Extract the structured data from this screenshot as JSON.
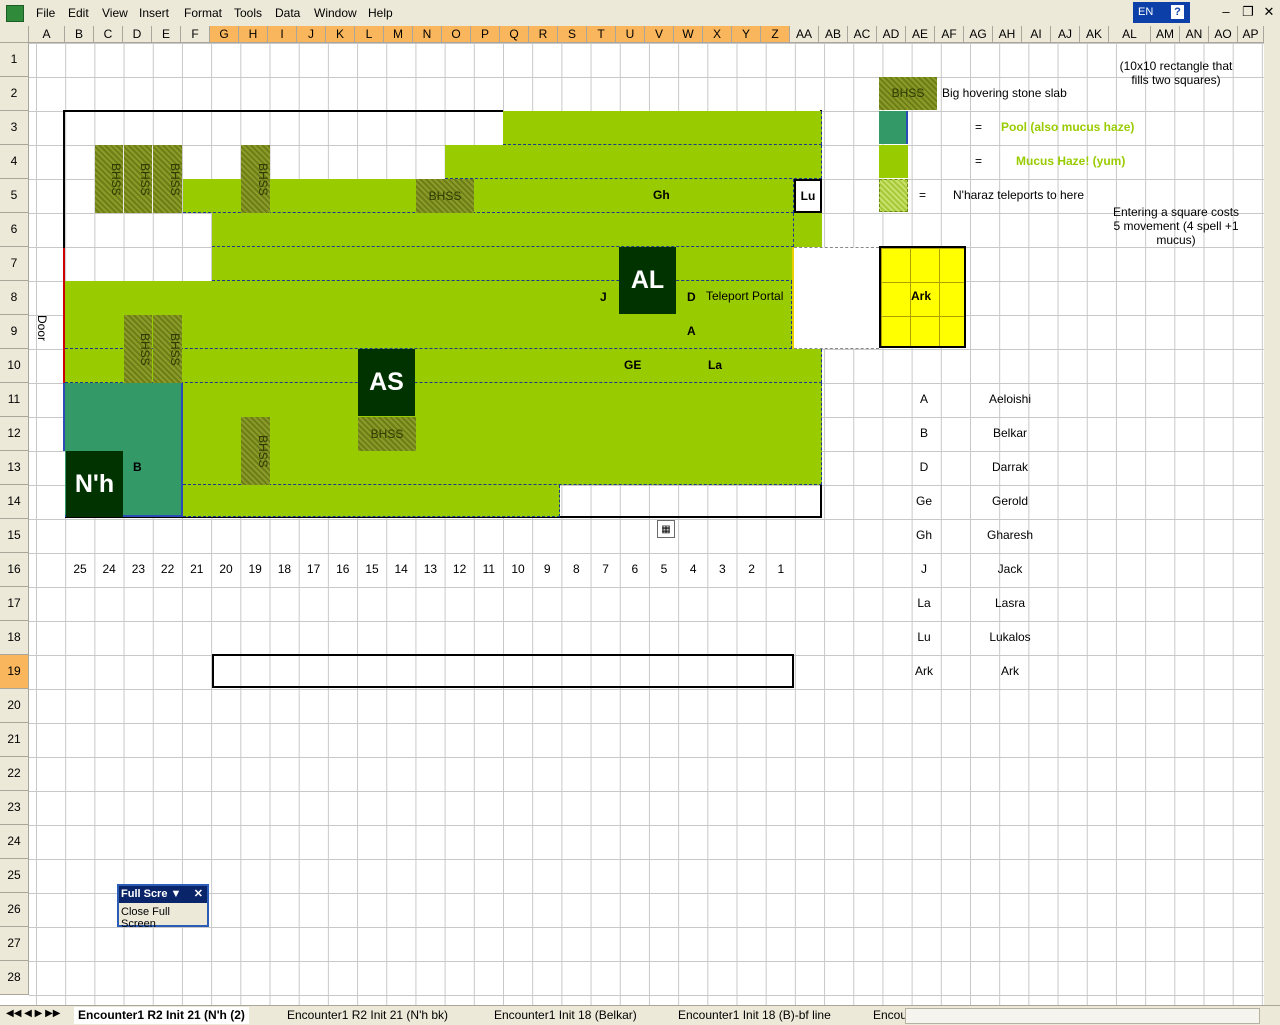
{
  "menu": [
    "File",
    "Edit",
    "View",
    "Insert",
    "Format",
    "Tools",
    "Data",
    "Window",
    "Help"
  ],
  "lang": "EN",
  "help": "?",
  "columns": [
    "A",
    "B",
    "C",
    "D",
    "E",
    "F",
    "G",
    "H",
    "I",
    "J",
    "K",
    "L",
    "M",
    "N",
    "O",
    "P",
    "Q",
    "R",
    "S",
    "T",
    "U",
    "V",
    "W",
    "X",
    "Y",
    "Z",
    "AA",
    "AB",
    "AC",
    "AD",
    "AE",
    "AF",
    "AG",
    "AH",
    "AI",
    "AJ",
    "AK",
    "AL",
    "AM",
    "AN",
    "AO",
    "AP"
  ],
  "rows": [
    "1",
    "2",
    "3",
    "4",
    "5",
    "6",
    "7",
    "8",
    "9",
    "10",
    "11",
    "12",
    "13",
    "14",
    "15",
    "16",
    "17",
    "18",
    "19",
    "20",
    "21",
    "22",
    "23",
    "24",
    "25",
    "26",
    "27",
    "28"
  ],
  "selected_row": "19",
  "map": {
    "door": "Door",
    "teleport": "Teleport Portal",
    "bhss": "BHSS",
    "tokens": {
      "AL": "AL",
      "AS": "AS",
      "Nh": "N'h",
      "Gh": "Gh",
      "Lu": "Lu",
      "J": "J",
      "D": "D",
      "A": "A",
      "GE": "GE",
      "La": "La",
      "B": "B"
    },
    "numbers": [
      "25",
      "24",
      "23",
      "22",
      "21",
      "20",
      "19",
      "18",
      "17",
      "16",
      "15",
      "14",
      "13",
      "12",
      "11",
      "10",
      "9",
      "8",
      "7",
      "6",
      "5",
      "4",
      "3",
      "2",
      "1"
    ]
  },
  "legend": {
    "note1": "(10x10 rectangle that fills two squares)",
    "bhss_label": "BHSS",
    "bhss_desc": "Big hovering stone slab",
    "eq": "=",
    "pool": "Pool (also mucus haze)",
    "mucus": "Mucus Haze! (yum)",
    "teleport_desc": "N'haraz teleports to here",
    "cost": "Entering a square costs 5 movement (4 spell +1 mucus)",
    "ark": "Ark"
  },
  "characters": [
    {
      "abbr": "A",
      "name": "Aeloishi"
    },
    {
      "abbr": "B",
      "name": "Belkar"
    },
    {
      "abbr": "D",
      "name": "Darrak"
    },
    {
      "abbr": "Ge",
      "name": "Gerold"
    },
    {
      "abbr": "Gh",
      "name": "Gharesh"
    },
    {
      "abbr": "J",
      "name": "Jack"
    },
    {
      "abbr": "La",
      "name": "Lasra"
    },
    {
      "abbr": "Lu",
      "name": "Lukalos"
    },
    {
      "abbr": "Ark",
      "name": "Ark"
    }
  ],
  "fullscreen": {
    "title": "Full Scre",
    "close": "Close Full Screen"
  },
  "tabs": [
    "Encounter1 R2  Init 21 (N'h (2)",
    "Encounter1 R2  Init 21 (N'h bk)",
    "Encounter1  Init 18 (Belkar)",
    "Encounter1  Init 18 (B)-bf line",
    "Encou"
  ],
  "colors": {
    "mucus": "#99cc00",
    "pool": "#339966",
    "token": "#003300",
    "ark": "#ffff00"
  }
}
